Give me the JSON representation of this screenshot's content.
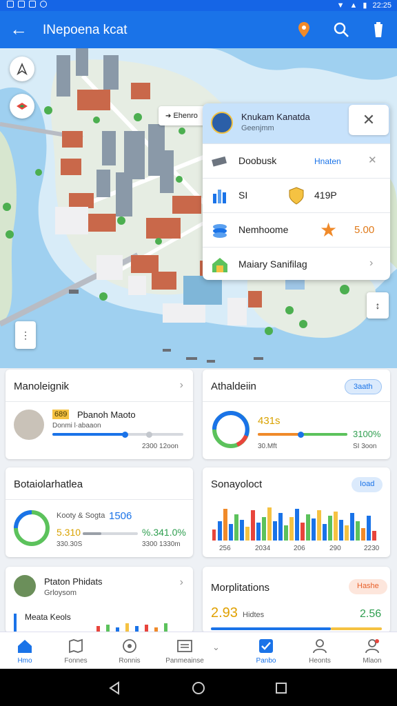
{
  "status_bar": {
    "time": "22:25"
  },
  "app_bar": {
    "title": "INepoena kcat",
    "back_icon": "arrow-left-icon",
    "actions": [
      "location-pin-icon",
      "search-icon",
      "battery-icon"
    ]
  },
  "map": {
    "chip_label": "Ehenro",
    "popup": {
      "header_title": "Knukam Kanatda",
      "header_subtitle": "Geenjmm",
      "rows": [
        {
          "label": "Doobusk",
          "action": "Hnaten"
        },
        {
          "label": "SI",
          "value": "419P"
        },
        {
          "label": "Nemhoome",
          "value": "5.00"
        },
        {
          "label": "Maiary Sanifilag"
        }
      ]
    }
  },
  "cards": {
    "c1": {
      "title": "Manoleignik",
      "name": "Pbanoh Maoto",
      "sub": "Donmi l·abaaon",
      "badge": "689",
      "footer": "2300  12oon",
      "progress": 0.55
    },
    "c2": {
      "title": "Athaldeiin",
      "pill": "3aath",
      "value": "431s",
      "right_value": "3100%",
      "left_footer": "30.Mft",
      "right_footer": "SI 3oon",
      "progress": 0.48
    },
    "c3": {
      "title": "Botaiolarhatlea",
      "label": "Kooty & Sogta",
      "label_value": "1506",
      "left_value": "5.310",
      "right_value": "%.341.0%",
      "left_footer": "330.30S",
      "right_footer": "3300  1330m",
      "progress": 0.34
    },
    "c4": {
      "title": "Sonayoloct",
      "pill": "Ioad",
      "ticks": [
        "256",
        "2034",
        "206",
        "290",
        "2230"
      ]
    },
    "c5": {
      "title": "Ptaton Phidats",
      "sub": "Grloysom",
      "small_label": "Meata Keols"
    },
    "c6": {
      "title": "Morplitations",
      "pill": "Hashe",
      "left_value": "2.93",
      "left_label": "Hidtes",
      "right_value": "2.56",
      "progress": 0.7
    }
  },
  "colors": {
    "primary": "#1a73e8",
    "green": "#5cc25c",
    "orange": "#f08a2a",
    "red": "#e8453c",
    "yellow": "#f5c242"
  },
  "bottom_nav": [
    {
      "label": "Hmo",
      "icon": "home-icon",
      "active": true
    },
    {
      "label": "Fonnes",
      "icon": "map-icon"
    },
    {
      "label": "Ronnis",
      "icon": "explore-icon"
    },
    {
      "label": "Panmeainse",
      "icon": "list-icon"
    },
    {
      "label": "Panbo",
      "icon": "check-icon",
      "active": true
    },
    {
      "label": "Heonts",
      "icon": "person-icon"
    },
    {
      "label": "Mlaon",
      "icon": "account-icon"
    }
  ]
}
